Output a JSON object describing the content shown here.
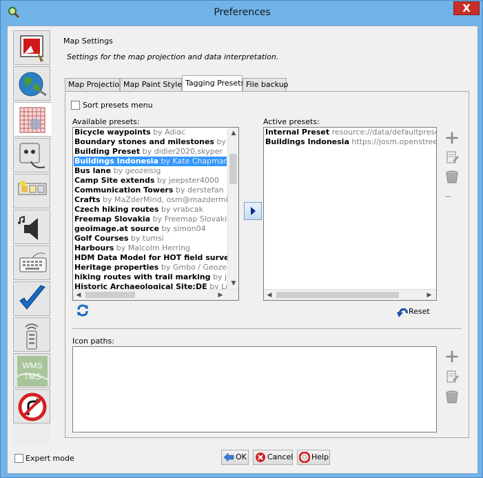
{
  "window": {
    "title": "Preferences",
    "close_label": "X"
  },
  "sidebar": {
    "items": [
      {
        "name": "display"
      },
      {
        "name": "connection"
      },
      {
        "name": "map-settings"
      },
      {
        "name": "plugins"
      },
      {
        "name": "toolbar"
      },
      {
        "name": "audio"
      },
      {
        "name": "shortcuts"
      },
      {
        "name": "validator"
      },
      {
        "name": "remote-control"
      },
      {
        "name": "imagery",
        "line1": "WMS",
        "line2": "TMS"
      },
      {
        "name": "projection"
      }
    ]
  },
  "content": {
    "title": "Map Settings",
    "subtitle": "Settings for the map projection and data interpretation."
  },
  "tabs": [
    "Map Projection",
    "Map Paint Styles",
    "Tagging Presets",
    "File backup"
  ],
  "presets": {
    "sort_label": "Sort presets menu",
    "available_label": "Available presets:",
    "active_label": "Active presets:",
    "icon_paths_label": "Icon paths:",
    "reset_label": "Reset",
    "available": [
      {
        "name": "Bicycle waypoints",
        "author": "by Adiac"
      },
      {
        "name": "Boundary stones and milestones",
        "author": "by Lübe"
      },
      {
        "name": "Building Preset",
        "author": "by didier2020,skyper"
      },
      {
        "name": "Buildings Indonesia",
        "author": "by Kate Chapman"
      },
      {
        "name": "Bus lane",
        "author": "by geozeisig"
      },
      {
        "name": "Camp Site extends",
        "author": "by jeepster4000"
      },
      {
        "name": "Communication Towers",
        "author": "by derstefan"
      },
      {
        "name": "Crafts",
        "author": "by MaZderMind, osm@mazdermind.de"
      },
      {
        "name": "Czech hiking routes",
        "author": "by vrabcak"
      },
      {
        "name": "Freemap Slovakia",
        "author": "by Freemap Slovakia"
      },
      {
        "name": "geoimage.at source",
        "author": "by simon04"
      },
      {
        "name": "Golf Courses",
        "author": "by tumsi"
      },
      {
        "name": "Harbours",
        "author": "by Malcolm Herring"
      },
      {
        "name": "HDM Data Model for HOT field surveys",
        "author": "by"
      },
      {
        "name": "Heritage properties",
        "author": "by Gmbo / Geozeisig"
      },
      {
        "name": "hiking routes with trail marking",
        "author": "by juestr"
      },
      {
        "name": "Historic Archaeological Site:DE",
        "author": "by Lutz"
      }
    ],
    "active": [
      {
        "name": "Internal Preset",
        "author": "resource://data/defaultpresets.xml"
      },
      {
        "name": "Buildings Indonesia",
        "author": "https://josm.openstreetmap.de"
      }
    ]
  },
  "footer": {
    "expert_label": "Expert mode",
    "ok_label": "OK",
    "cancel_label": "Cancel",
    "help_label": "Help"
  },
  "colors": {
    "selection": "#3399ff",
    "title_bar": "#70b3e8",
    "close_button": "#c7302a"
  }
}
